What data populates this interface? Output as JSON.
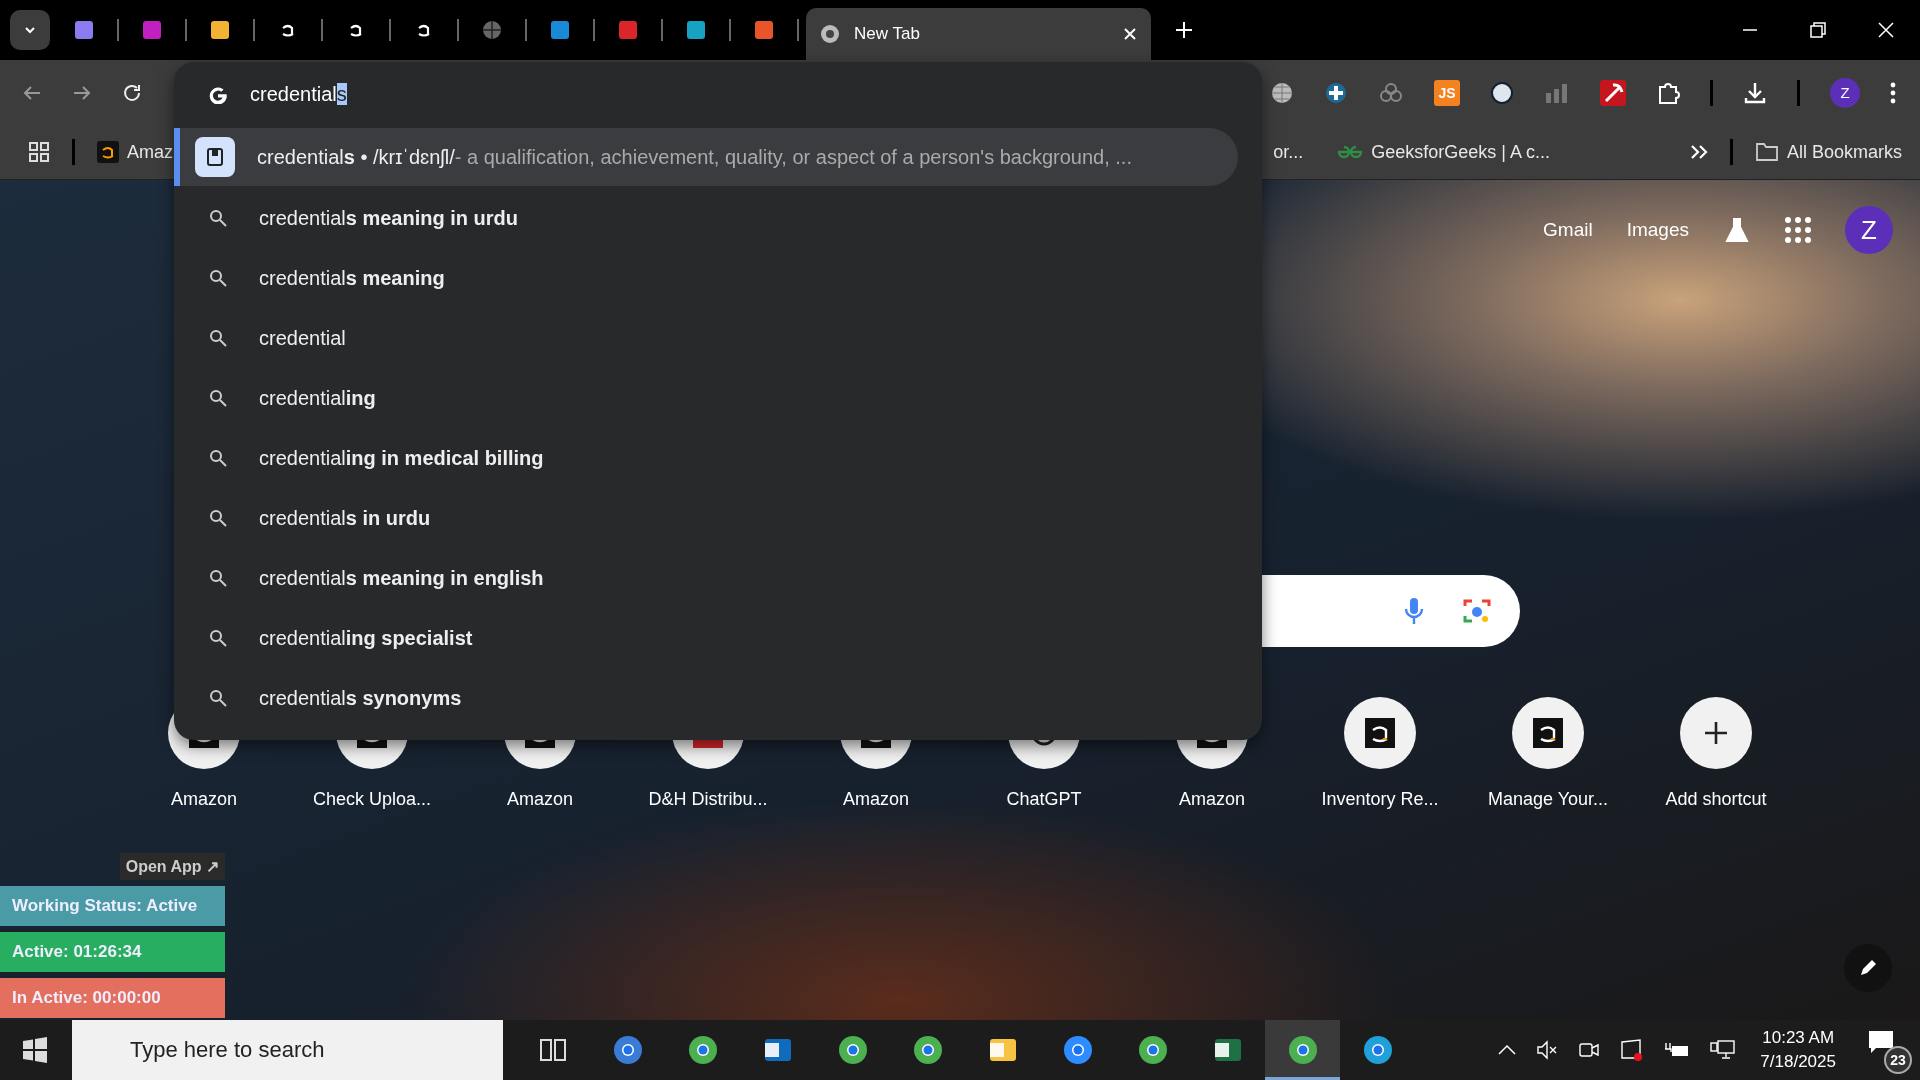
{
  "tabs": [
    {
      "selected": false
    },
    {
      "selected": false
    },
    {
      "selected": false
    },
    {
      "selected": false
    },
    {
      "selected": false
    },
    {
      "selected": false
    },
    {
      "selected": false
    },
    {
      "selected": false
    },
    {
      "selected": false
    },
    {
      "selected": false
    },
    {
      "selected": false
    },
    {
      "title": "New Tab",
      "selected": true
    }
  ],
  "toolbar": {
    "js_label": "JS",
    "profile_initial": "Z"
  },
  "omnibox": {
    "typed": "credential",
    "autocomplete": "s",
    "suggestions": [
      {
        "kind": "answer",
        "text": "credential**s** • /krɪˈdɛnʃl/",
        "description": "- a qualification, achievement, quality, or aspect of a person's background, ...",
        "selected": true
      },
      {
        "kind": "search",
        "text": "credential**s meaning in urdu**",
        "selected": false
      },
      {
        "kind": "search",
        "text": "credential**s meaning**",
        "selected": false
      },
      {
        "kind": "search",
        "text": "credential",
        "selected": false
      },
      {
        "kind": "search",
        "text": "credential**ing**",
        "selected": false
      },
      {
        "kind": "search",
        "text": "credential**ing in medical billing**",
        "selected": false
      },
      {
        "kind": "search",
        "text": "credential**s in urdu**",
        "selected": false
      },
      {
        "kind": "search",
        "text": "credential**s meaning in english**",
        "selected": false
      },
      {
        "kind": "search",
        "text": "credential**ing specialist**",
        "selected": false
      },
      {
        "kind": "search",
        "text": "credential**s synonyms**",
        "selected": false
      }
    ]
  },
  "bookmarks": {
    "left": "Amaz",
    "right": [
      {
        "title": "or..."
      },
      {
        "title": "GeeksforGeeks | A c..."
      }
    ],
    "all": "All Bookmarks"
  },
  "header": {
    "links": [
      "Gmail",
      "Images"
    ],
    "account_initial": "Z"
  },
  "shortcuts": [
    {
      "kind": "site",
      "title": "Amazon"
    },
    {
      "kind": "site",
      "title": "Check Uploa..."
    },
    {
      "kind": "site",
      "title": "Amazon"
    },
    {
      "kind": "site",
      "title": "D&H Distribu..."
    },
    {
      "kind": "site",
      "title": "Amazon"
    },
    {
      "kind": "site",
      "title": "ChatGPT"
    },
    {
      "kind": "site",
      "title": "Amazon"
    },
    {
      "kind": "site",
      "title": "Inventory Re..."
    },
    {
      "kind": "site",
      "title": "Manage Your..."
    },
    {
      "kind": "add",
      "title": "Add shortcut"
    }
  ],
  "tracker": {
    "open_app": "Open App ↗",
    "statuses": [
      {
        "text": "Working Status: Active",
        "color": "#4a9ba6"
      },
      {
        "text": "Active: 01:26:34",
        "color": "#27ae60"
      },
      {
        "text": "In Active: 00:00:00",
        "color": "#e56f5e"
      }
    ]
  },
  "taskbar": {
    "search": {
      "placeholder": "Type here to search"
    },
    "apps": [
      {
        "selected": false
      },
      {
        "selected": false
      },
      {
        "selected": false
      },
      {
        "selected": false
      },
      {
        "selected": false
      },
      {
        "selected": false
      },
      {
        "selected": false
      },
      {
        "selected": false
      },
      {
        "selected": false
      },
      {
        "selected": false
      },
      {
        "selected": true
      },
      {
        "selected": false
      }
    ],
    "time": "10:23 AM",
    "date": "7/18/2025",
    "notification_count": "23"
  }
}
